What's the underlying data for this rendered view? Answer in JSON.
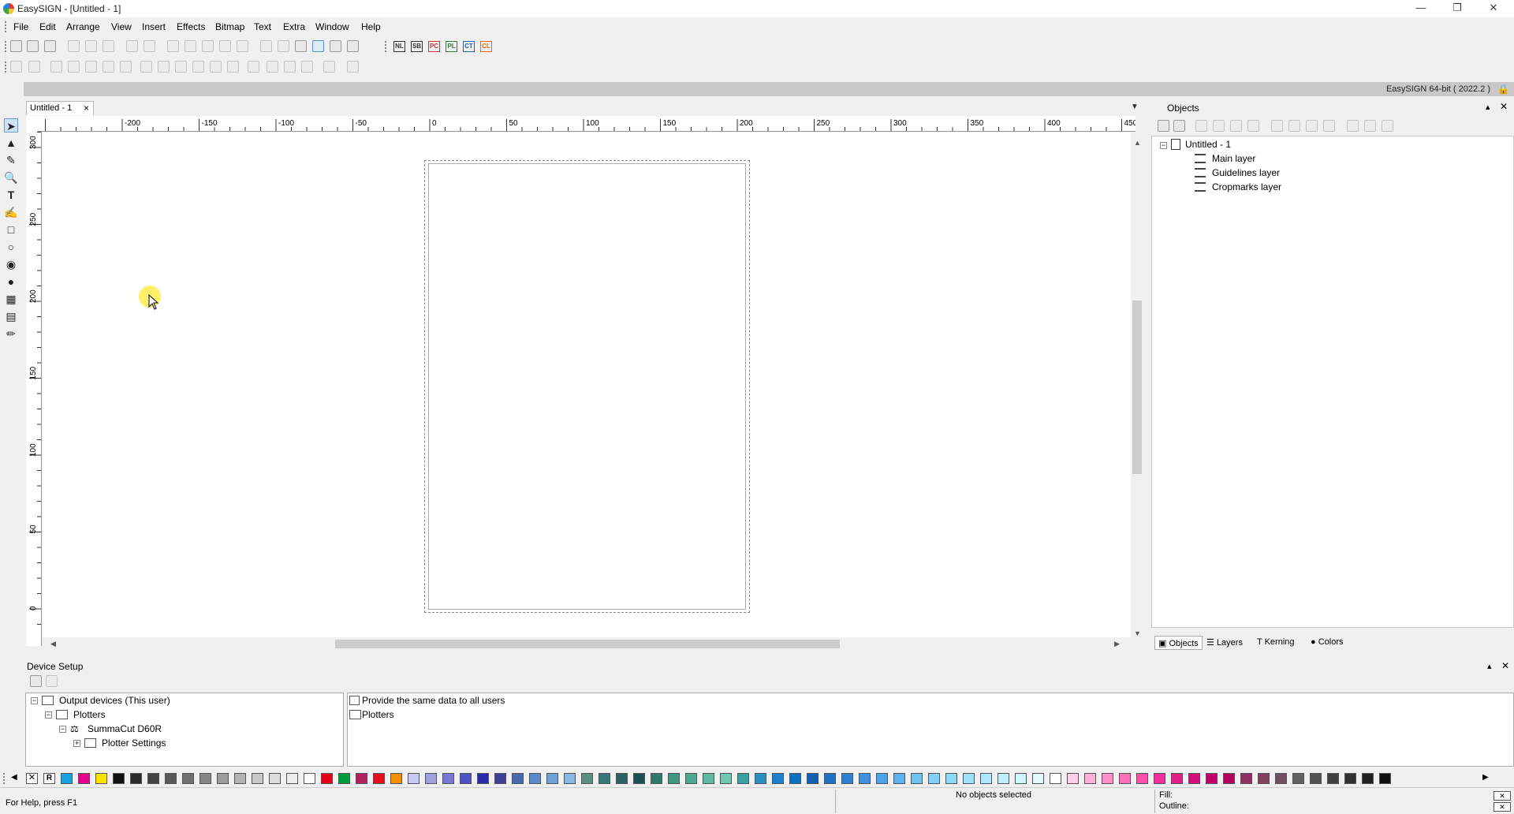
{
  "window": {
    "title": "EasySIGN - [Untitled - 1]"
  },
  "menu": [
    "File",
    "Edit",
    "Arrange",
    "View",
    "Insert",
    "Effects",
    "Bitmap",
    "Text",
    "Extra",
    "Window",
    "Help"
  ],
  "toolbar_codes": [
    "NL",
    "SB",
    "PC",
    "PL",
    "CT",
    "CL"
  ],
  "toolbar_code_colors": [
    "#333333",
    "#333333",
    "#d32f2f",
    "#2e7d32",
    "#1565c0",
    "#ef6c00"
  ],
  "version_info": "EasySIGN 64-bit ( 2022.2 )",
  "document_tab": {
    "label": "Untitled - 1",
    "close": "×"
  },
  "ruler": {
    "h_labels": [
      "-200",
      "-150",
      "-100",
      "-50",
      "0",
      "50",
      "100",
      "150",
      "200",
      "250",
      "300",
      "350",
      "400",
      "450"
    ],
    "v_labels": [
      "300",
      "250",
      "200",
      "150",
      "100",
      "50",
      "0"
    ]
  },
  "objects_panel": {
    "title": "Objects",
    "tree": {
      "root": "Untitled - 1",
      "children": [
        "Main layer",
        "Guidelines layer",
        "Cropmarks layer"
      ]
    },
    "tabs": [
      "Objects",
      "Layers",
      "Kerning",
      "Colors"
    ]
  },
  "device_setup": {
    "title": "Device Setup",
    "tree": [
      "Output devices (This user)",
      "Plotters",
      "SummaCut D60R",
      "Plotter Settings"
    ],
    "list": [
      "Provide the same data to all users",
      "Plotters"
    ]
  },
  "palette": [
    "#1ba1e2",
    "#e3008c",
    "#f9e400",
    "#111111",
    "#2b2b2b",
    "#444444",
    "#5a5a5a",
    "#707070",
    "#868686",
    "#9c9c9c",
    "#b2b2b2",
    "#c8c8c8",
    "#dcdcdc",
    "#eeeeee",
    "#ffffff",
    "#e0001b",
    "#009a3e",
    "#b22060",
    "#e01020",
    "#f39000",
    "#c8c8f0",
    "#a0a0e0",
    "#7878d0",
    "#5050c0",
    "#2a2aa8",
    "#404090",
    "#4a6ab0",
    "#5a8ac8",
    "#70a0d8",
    "#88b8e0",
    "#5a9080",
    "#3a7878",
    "#2a6060",
    "#1a5050",
    "#307868",
    "#409880",
    "#50a890",
    "#60b8a0",
    "#70c8b0",
    "#3aa0a0",
    "#2a90c0",
    "#1a80d0",
    "#0a70c0",
    "#1060b0",
    "#2070c0",
    "#3080d0",
    "#4090e0",
    "#50a0e8",
    "#60b0f0",
    "#70c0f0",
    "#80d0f8",
    "#90d8f8",
    "#a0e0f8",
    "#b0e8fa",
    "#c0eefc",
    "#d0f4fc",
    "#e0f8fe",
    "#ffffff",
    "#ffd0e8",
    "#ffb0d8",
    "#ff90c8",
    "#ff70b8",
    "#ff50a8",
    "#f03098",
    "#e02088",
    "#d01078",
    "#c00068",
    "#b00058",
    "#903060",
    "#804060",
    "#705060",
    "#606060",
    "#505050",
    "#404040",
    "#303030",
    "#202020",
    "#101010"
  ],
  "status": {
    "help": "For Help, press F1",
    "selection": "No objects selected",
    "fill": "Fill:",
    "outline": "Outline:"
  }
}
